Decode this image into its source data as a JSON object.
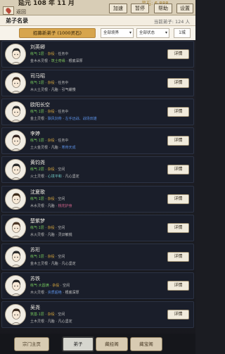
{
  "topbar": {
    "date": "延元 108 年 11 月",
    "return_label": "返回",
    "spirit_stones": "灵石: 6,888",
    "buttons": {
      "speed": "加速",
      "pause": "暂停",
      "help": "帮助",
      "settings": "设置"
    }
  },
  "header": {
    "title": "弟子名录",
    "count": "当前弟子: 124 人"
  },
  "filters": {
    "recruit": "招募新弟子 (1000灵石)",
    "realm": "全部境界",
    "status": "全部状态",
    "hire": "1城"
  },
  "disciples": [
    {
      "name": "刘英卿",
      "realm": "练气·1层",
      "grade": "杂役",
      "status": "任务中",
      "root": "金木水灵根",
      "talent": "筑士奇缘",
      "trait": "根底深厚",
      "talent_color": "#7ec05c",
      "trait_color": "#c8c8c8",
      "detail": "详情"
    },
    {
      "name": "司马昭",
      "realm": "练气·1层",
      "grade": "杂役",
      "status": "任务中",
      "root": "木火土灵根",
      "talent": "凡胎",
      "trait": "引气缓慢",
      "talent_color": "#c8c8c8",
      "trait_color": "#c8c8c8",
      "detail": "详情"
    },
    {
      "name": "欧阳长空",
      "realm": "练气·1层",
      "grade": "杂役",
      "status": "任务中",
      "root": "金土灵根",
      "talent": "飘风剑骨",
      "trait": "左手远战、战场双雄",
      "talent_color": "#5a8ee0",
      "trait_color": "#5a8ee0",
      "detail": "详情"
    },
    {
      "name": "李婷",
      "realm": "练气·1层",
      "grade": "杂役",
      "status": "任务中",
      "root": "土火金灵根",
      "talent": "凡胎",
      "trait": "寒骨天成",
      "talent_color": "#c8c8c8",
      "trait_color": "#5a8ee0",
      "detail": "详情"
    },
    {
      "name": "黄钧尧",
      "realm": "练气·2层",
      "grade": "杂役",
      "status": "空闲",
      "root": "火土灵根",
      "talent": "心境平和",
      "trait": "凡心坚定",
      "talent_color": "#6fc7c1",
      "trait_color": "#c8c8c8",
      "detail": "详情"
    },
    {
      "name": "沈夏歌",
      "realm": "练气·1层",
      "grade": "杂役",
      "status": "空闲",
      "root": "木水灵根",
      "talent": "凡胎",
      "trait": "桃花护身",
      "talent_color": "#c8c8c8",
      "trait_color": "#d7668e",
      "detail": "详情"
    },
    {
      "name": "楚紫梦",
      "realm": "练气·1层",
      "grade": "杂役",
      "status": "空闲",
      "root": "水火灵根",
      "talent": "凡胎",
      "trait": "灵识敏锐",
      "talent_color": "#c8c8c8",
      "trait_color": "#c8c8c8",
      "detail": "详情"
    },
    {
      "name": "苏珩",
      "realm": "练气·1层",
      "grade": "杂役",
      "status": "空闲",
      "root": "金木土灵根",
      "talent": "凡胎",
      "trait": "凡心坚定",
      "talent_color": "#c8c8c8",
      "trait_color": "#c8c8c8",
      "detail": "详情"
    },
    {
      "name": "苏铁",
      "realm": "练气·大圆满",
      "grade": "杂役",
      "status": "空闲",
      "root": "木火灵根",
      "talent": "资质超绝",
      "trait": "根底深厚",
      "talent_color": "#5a8ee0",
      "trait_color": "#c8c8c8",
      "detail": "详情"
    },
    {
      "name": "吴尧",
      "realm": "筑基·1层",
      "grade": "杂役",
      "status": "空闲",
      "root": "土木灵根",
      "talent": "凡胎",
      "trait": "凡心坚定",
      "talent_color": "#c8c8c8",
      "trait_color": "#c8c8c8",
      "detail": "详情"
    }
  ],
  "bottom_nav": [
    {
      "label": "宗门主页",
      "active": false
    },
    {
      "label": "弟子",
      "active": true
    },
    {
      "label": "藏经阁",
      "active": false
    },
    {
      "label": "藏宝阁",
      "active": false
    }
  ],
  "colors": {
    "realm_green": "#72c25c",
    "grade_gold": "#d8a83e",
    "status_grey": "#b9b9b9"
  }
}
